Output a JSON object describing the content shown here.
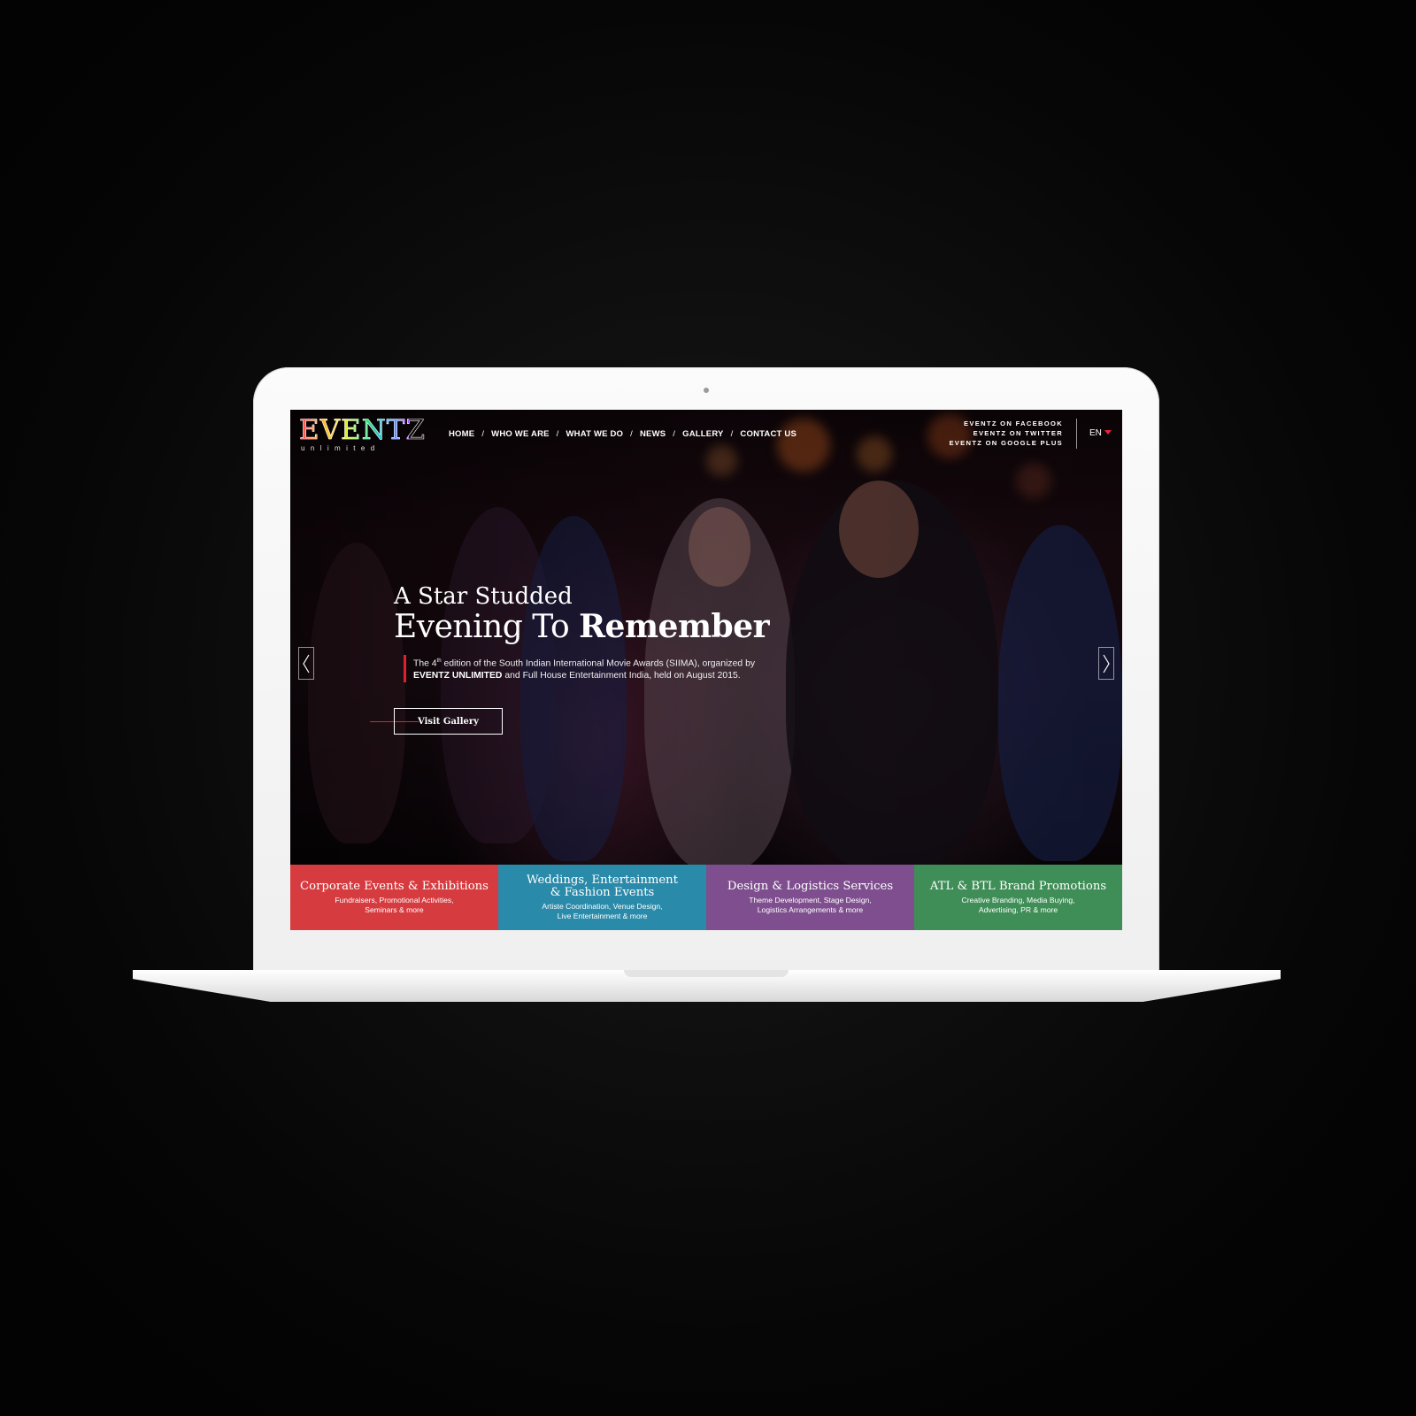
{
  "brand": {
    "name": "EVENTZ",
    "tagline": "unlimited"
  },
  "nav": {
    "items": [
      {
        "label": "HOME"
      },
      {
        "label": "WHO WE ARE"
      },
      {
        "label": "WHAT WE DO"
      },
      {
        "label": "NEWS"
      },
      {
        "label": "GALLERY"
      },
      {
        "label": "CONTACT US"
      }
    ],
    "separator": "/"
  },
  "social": {
    "facebook": "EVENTZ ON FACEBOOK",
    "twitter": "EVENTZ ON TWITTER",
    "google_plus": "EVENTZ ON GOOGLE PLUS"
  },
  "language": {
    "selected": "EN"
  },
  "hero": {
    "headline_line1": "A Star Studded",
    "headline_line2_regular": "Evening To ",
    "headline_line2_bold": "Remember",
    "desc_part1": "The 4",
    "desc_sup": "th",
    "desc_part2": " edition of the South Indian International Movie Awards (SIIMA), organized by ",
    "desc_bold": "EVENTZ UNLIMITED",
    "desc_part3": " and Full House Entertainment India, held on August 2015.",
    "cta_label": "Visit Gallery"
  },
  "services": [
    {
      "title": "Corporate Events & Exhibitions",
      "subtitle": "Fundraisers, Promotional Activities,\nSeminars & more",
      "color": "#d63b3f"
    },
    {
      "title": "Weddings, Entertainment\n& Fashion Events",
      "subtitle": "Artiste Coordination, Venue Design,\nLive Entertainment & more",
      "color": "#2a8aaa"
    },
    {
      "title": "Design & Logistics Services",
      "subtitle": "Theme Development, Stage Design,\nLogistics Arrangements & more",
      "color": "#7e4e8e"
    },
    {
      "title": "ATL & BTL Brand Promotions",
      "subtitle": "Creative Branding, Media Buying,\nAdvertising, PR & more",
      "color": "#3f8e57"
    }
  ],
  "icons": {
    "prev": "chevron-left-icon",
    "next": "chevron-right-icon",
    "lang": "caret-down-icon"
  },
  "colors": {
    "accent_red": "#e0202e",
    "background": "#050505",
    "laptop_body": "#f4f4f4"
  }
}
